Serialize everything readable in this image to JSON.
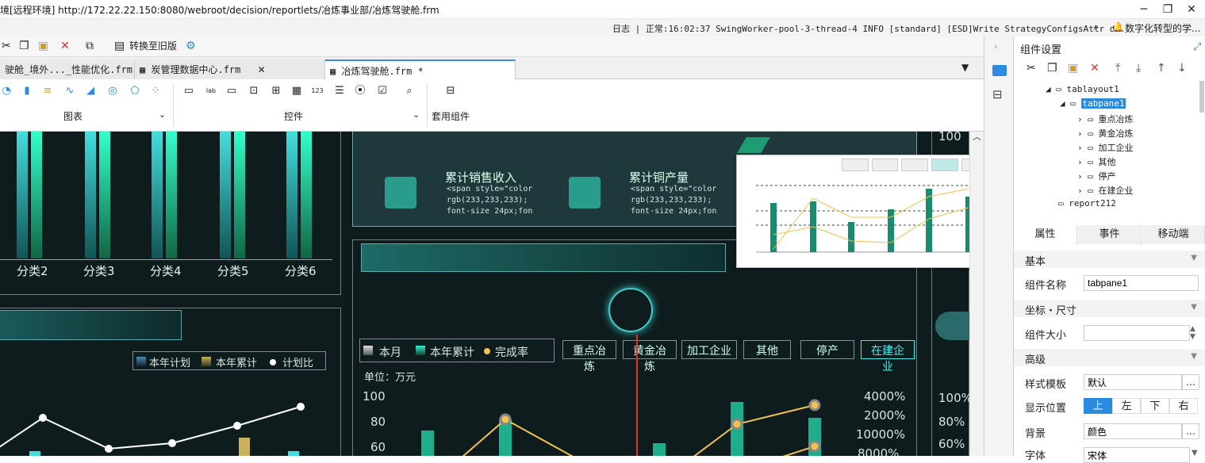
{
  "window": {
    "title": "境[远程环境]    http://172.22.22.150:8080/webroot/decision/reportlets/冶炼事业部/冶炼驾驶舱.frm",
    "minimize": "─",
    "maximize": "❐",
    "close": "✕"
  },
  "logbar": {
    "text": "日志 | 正常:16:02:37 SwingWorker-pool-3-thread-4 INFO [standard] [ESD]Write StrategyConfigsAttr d...",
    "notice": "数字化转型的学..."
  },
  "toolbar": {
    "switch_label": "转换至旧版"
  },
  "tabs": [
    {
      "label": "驶舱_境外..._性能优化.frm"
    },
    {
      "label": "炭管理数据中心.frm"
    },
    {
      "label": "冶炼驾驶舱.frm *"
    }
  ],
  "ribbon": {
    "group_chart": "图表",
    "group_control": "控件",
    "group_template": "套用组件"
  },
  "canvas": {
    "categories": [
      "分类2",
      "分类3",
      "分类4",
      "分类5",
      "分类6"
    ],
    "card_sales_title": "累计销售收入",
    "card_copper_title": "累计铜产量",
    "html_snip_1": "<span style=\"color",
    "html_snip_2": "rgb(233,233,233);",
    "html_snip_3": "font-size 24px;fon",
    "legend_left": [
      "本年计划",
      "本年累计",
      "计划比"
    ],
    "legend_mid": [
      "本月",
      "本年累计",
      "完成率"
    ],
    "unit_label": "单位：万元",
    "category_tags": [
      "重点冶炼",
      "黄金冶炼",
      "加工企业",
      "其他",
      "停产",
      "在建企业"
    ],
    "left_axis": [
      "100",
      "80",
      "60"
    ],
    "right_axis": [
      "4000%",
      "2000%",
      "10000%",
      "8000%"
    ],
    "far_right_axis": [
      "100%",
      "80%",
      "60%"
    ],
    "top_right_value": "100"
  },
  "panel": {
    "title": "组件设置",
    "tree": [
      {
        "label": "tablayout1"
      },
      {
        "label": "tabpane1"
      },
      {
        "label": "重点冶炼"
      },
      {
        "label": "黄金冶炼"
      },
      {
        "label": "加工企业"
      },
      {
        "label": "其他"
      },
      {
        "label": "停产"
      },
      {
        "label": "在建企业"
      },
      {
        "label": "report212"
      }
    ],
    "tabs": [
      "属性",
      "事件",
      "移动端"
    ],
    "sec_basic": "基本",
    "name_label": "组件名称",
    "name_value": "tabpane1",
    "sec_coord": "坐标・尺寸",
    "size_label": "组件大小",
    "sec_adv": "高级",
    "style_label": "样式模板",
    "style_value": "默认",
    "display_label": "显示位置",
    "display_options": [
      "上",
      "左",
      "下",
      "右"
    ],
    "bg_label": "背景",
    "bg_value": "颜色",
    "font_label": "字体",
    "font_value": "宋体"
  }
}
